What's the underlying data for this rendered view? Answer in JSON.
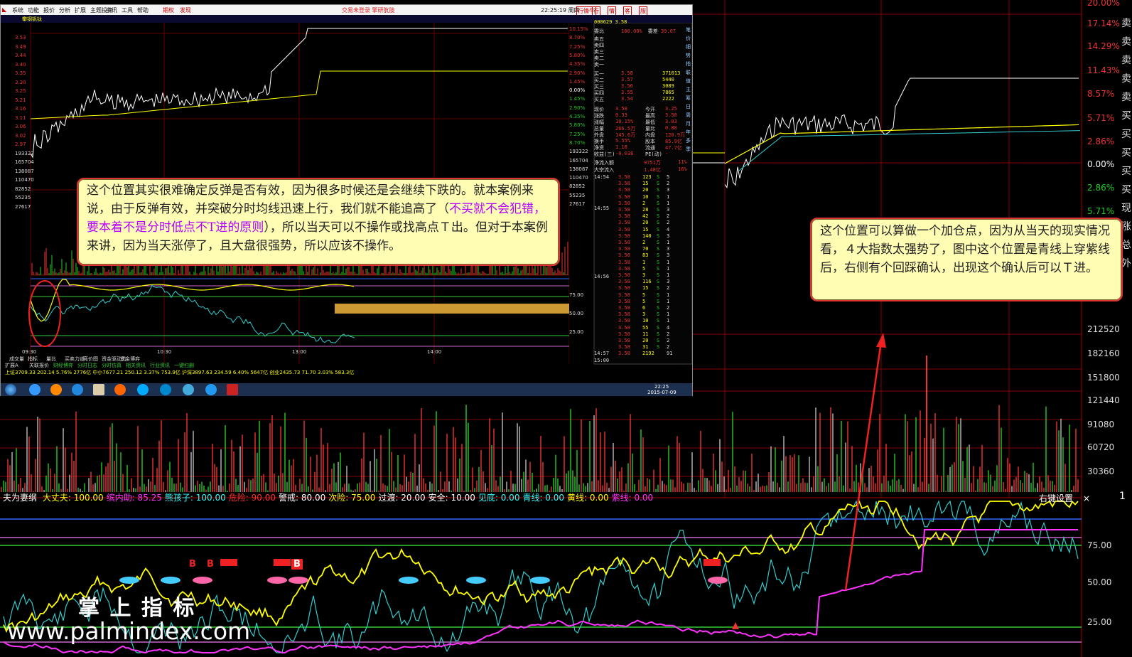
{
  "right_axis": {
    "pct_labels": [
      {
        "text": "20.00%",
        "color": "#e33"
      },
      {
        "text": "17.14%",
        "color": "#e33"
      },
      {
        "text": "14.29%",
        "color": "#e33"
      },
      {
        "text": "11.43%",
        "color": "#e33"
      },
      {
        "text": "8.57%",
        "color": "#e33"
      },
      {
        "text": "5.71%",
        "color": "#e33"
      },
      {
        "text": "2.86%",
        "color": "#e33"
      },
      {
        "text": "0.00%",
        "color": "#fff"
      },
      {
        "text": "2.86%",
        "color": "#2c2"
      },
      {
        "text": "5.71%",
        "color": "#2c2"
      }
    ],
    "vol_labels": [
      "212520",
      "182160",
      "151800",
      "121440",
      "91080",
      "60720",
      "30360"
    ],
    "osc_labels": [
      "75.00",
      "50.00",
      "25.00"
    ],
    "top_right_cut": "1"
  },
  "right_vertical_tabs": [
    "卖",
    "卖",
    "卖",
    "卖",
    "卖",
    "买",
    "买",
    "买",
    "买",
    "买",
    "现",
    "涨",
    "总",
    "外"
  ],
  "oscillator": {
    "name": "夫为妻纲",
    "items": [
      {
        "label": "大丈夫:",
        "value": "100.00",
        "color": "#ff0"
      },
      {
        "label": "缤内助:",
        "value": "85.25",
        "color": "#f3f"
      },
      {
        "label": "熊孩子:",
        "value": "100.00",
        "color": "#3ff"
      },
      {
        "label": "危险:",
        "value": "90.00",
        "color": "#f33"
      },
      {
        "label": "警戒:",
        "value": "80.00",
        "color": "#fff"
      },
      {
        "label": "次险:",
        "value": "75.00",
        "color": "#ff0"
      },
      {
        "label": "过渡:",
        "value": "20.00",
        "color": "#fff"
      },
      {
        "label": "安全:",
        "value": "10.00",
        "color": "#fff"
      },
      {
        "label": "见底:",
        "value": "0.00",
        "color": "#3ff"
      },
      {
        "label": "青线:",
        "value": "0.00",
        "color": "#3ff"
      },
      {
        "label": "黄线:",
        "value": "0.00",
        "color": "#ff0"
      },
      {
        "label": "紫线:",
        "value": "0.00",
        "color": "#f3f"
      }
    ],
    "settings_label": "右键设置",
    "close": "×"
  },
  "annotation_left": {
    "part1": "这个位置其实很难确定反弹是否有效，因为很多时候还是会继续下跌的。就本案例来说，由于反弹有效，并突破分时均线迅速上行，我们就不能追高了（",
    "highlight": "不买就不会犯错，要本着不是分时低点不T进的原则",
    "part2": "），所以当天可以不操作或找高点Ｔ出。但对于本案例来讲，因为当天涨停了，且大盘很强势，所以应该不操作。"
  },
  "annotation_right": "这个位置可以算做一个加仓点，因为从当天的现实情况看，４大指数太强势了，图中这个位置是青线上穿紫线后，右侧有个回踩确认，出现这个确认后可以Ｔ进。",
  "watermark": {
    "title": "掌 上 指 标",
    "url": "www.palmindex.com"
  },
  "markers": {
    "b": "B"
  },
  "inset": {
    "menu": [
      "系统",
      "功能",
      "报价",
      "分析",
      "扩展",
      "主题投资",
      "资讯",
      "工具",
      "帮助"
    ],
    "menu_tabs": [
      "期权",
      "发现"
    ],
    "title": "交易未登录  擎研肮肢",
    "time": "22:25:19 周四",
    "trade_buttons": [
      "行情牛",
      "行",
      "情",
      "客",
      "服"
    ],
    "stock_code": "000629",
    "stock_name": "攀钢钒钛",
    "left_y_labels": [
      "3.53",
      "3.49",
      "3.44",
      "3.40",
      "3.35",
      "3.30",
      "3.25",
      "3.21",
      "3.16",
      "3.11",
      "3.06",
      "3.02",
      "2.97",
      "193322",
      "165704",
      "138087",
      "110470",
      "82852",
      "55235",
      "27617"
    ],
    "right_pct_labels": [
      "10.15%",
      "8.70%",
      "7.25%",
      "5.80%",
      "4.35%",
      "2.90%",
      "1.45%",
      "0.00%",
      "1.45%",
      "2.90%",
      "4.35%",
      "5.80%",
      "7.25%",
      "8.70%",
      "193322",
      "165704",
      "138087",
      "110470",
      "82852",
      "55235",
      "27617"
    ],
    "osc_right": [
      "75.00",
      "50.00",
      "25.00"
    ],
    "time_axis": [
      "09:30",
      "10:30",
      "13:00",
      "14:00"
    ],
    "bottom_tabs": [
      "成交量",
      "指标",
      "量比",
      "买卖力道",
      "竞价图",
      "资金驱动力",
      "资金博弈"
    ],
    "bottom_tabs2": [
      "扩展A",
      "关联报价",
      "财经博弈",
      "分时日志",
      "分时仿真",
      "相关资讯",
      "行业资讯",
      "一键扫删"
    ],
    "index_bar": "上证3709.33 202.14 5.76% 2776亿 中小7677.21 250.12 3.37% 753.9亿 沪深3897.63 234.59 6.40% 5647亿 创业2435.73 71.70 3.03% 583.3亿",
    "quote_panel": {
      "weibi": "100.00%",
      "weicha": "39.07",
      "sell": [
        "卖五",
        "卖四",
        "卖三",
        "卖二",
        "卖一"
      ],
      "buy": [
        {
          "label": "买一",
          "price": "3.58",
          "vol": "371013"
        },
        {
          "label": "买二",
          "price": "3.57",
          "vol": "5440"
        },
        {
          "label": "买三",
          "price": "3.56",
          "vol": "3089"
        },
        {
          "label": "买四",
          "price": "3.55",
          "vol": "7865"
        },
        {
          "label": "买五",
          "price": "3.54",
          "vol": "2222"
        }
      ],
      "stats": [
        {
          "l": "现价",
          "v": "3.58",
          "l2": "今开",
          "v2": "3.25"
        },
        {
          "l": "涨跌",
          "v": "0.33",
          "l2": "最高",
          "v2": "3.58"
        },
        {
          "l": "涨幅",
          "v": "10.15%",
          "l2": "最低",
          "v2": "3.03"
        },
        {
          "l": "总量",
          "v": "266.5万",
          "l2": "量比",
          "v2": "0.88"
        },
        {
          "l": "外盘",
          "v": "145.6万",
          "l2": "内盘",
          "v2": "120.9万"
        },
        {
          "l": "换手",
          "v": "5.55%",
          "l2": "股本",
          "v2": "85.9亿"
        },
        {
          "l": "净资",
          "v": "1.18",
          "l2": "流通",
          "v2": "47.7亿"
        },
        {
          "l": "收益(三)",
          "v": "-0.038",
          "l2": "PE(动)",
          "v2": "-"
        }
      ],
      "flows": [
        {
          "l": "净流入额",
          "v": "9751万",
          "p": "11%"
        },
        {
          "l": "大宗流入",
          "v": "1.48亿",
          "p": "16%"
        }
      ],
      "tick_times": [
        "14:54",
        "14:55",
        "14:56",
        "14:57",
        "15:00"
      ],
      "ticks": [
        {
          "p": "3.58",
          "v": "123",
          "s": "S",
          "n": "5"
        },
        {
          "p": "3.58",
          "v": "15",
          "s": "S",
          "n": "2"
        },
        {
          "p": "3.58",
          "v": "20",
          "s": "S",
          "n": "3"
        },
        {
          "p": "3.58",
          "v": "10",
          "s": "S",
          "n": "1"
        },
        {
          "p": "3.58",
          "v": "2",
          "s": "S",
          "n": "1"
        },
        {
          "p": "3.58",
          "v": "28",
          "s": "S",
          "n": "3"
        },
        {
          "p": "3.58",
          "v": "42",
          "s": "S",
          "n": "2"
        },
        {
          "p": "3.58",
          "v": "20",
          "s": "S",
          "n": "2"
        },
        {
          "p": "3.58",
          "v": "15",
          "s": "S",
          "n": "4"
        },
        {
          "p": "3.58",
          "v": "140",
          "s": "S",
          "n": "3"
        },
        {
          "p": "3.58",
          "v": "2",
          "s": "S",
          "n": "1"
        },
        {
          "p": "3.58",
          "v": "70",
          "s": "S",
          "n": "3"
        },
        {
          "p": "3.58",
          "v": "83",
          "s": "S",
          "n": "3"
        },
        {
          "p": "3.58",
          "v": "1",
          "s": "S",
          "n": "1"
        },
        {
          "p": "3.58",
          "v": "5",
          "s": "S",
          "n": "1"
        },
        {
          "p": "3.58",
          "v": "3",
          "s": "S",
          "n": "1"
        },
        {
          "p": "3.58",
          "v": "116",
          "s": "S",
          "n": "3"
        },
        {
          "p": "3.58",
          "v": "15",
          "s": "S",
          "n": "2"
        },
        {
          "p": "3.58",
          "v": "5",
          "s": "S",
          "n": "1"
        },
        {
          "p": "3.58",
          "v": "5",
          "s": "S",
          "n": "1"
        },
        {
          "p": "3.58",
          "v": "6",
          "s": "S",
          "n": "2"
        },
        {
          "p": "3.58",
          "v": "3",
          "s": "S",
          "n": "1"
        },
        {
          "p": "3.58",
          "v": "10",
          "s": "S",
          "n": "1"
        },
        {
          "p": "3.58",
          "v": "55",
          "s": "S",
          "n": "4"
        },
        {
          "p": "3.58",
          "v": "11",
          "s": "S",
          "n": "2"
        },
        {
          "p": "3.58",
          "v": "20",
          "s": "S",
          "n": "2"
        },
        {
          "p": "3.58",
          "v": "31",
          "s": "S",
          "n": "2"
        },
        {
          "p": "3.58",
          "v": "2192",
          "s": "",
          "n": "91"
        }
      ],
      "side_tabs": [
        "笔",
        "价",
        "细",
        "势",
        "指",
        "联",
        "值",
        "主",
        "筹",
        "日",
        "周",
        "月",
        "年",
        "多",
        "季"
      ]
    },
    "taskbar_time": "22:25",
    "taskbar_date": "2015-07-09"
  }
}
